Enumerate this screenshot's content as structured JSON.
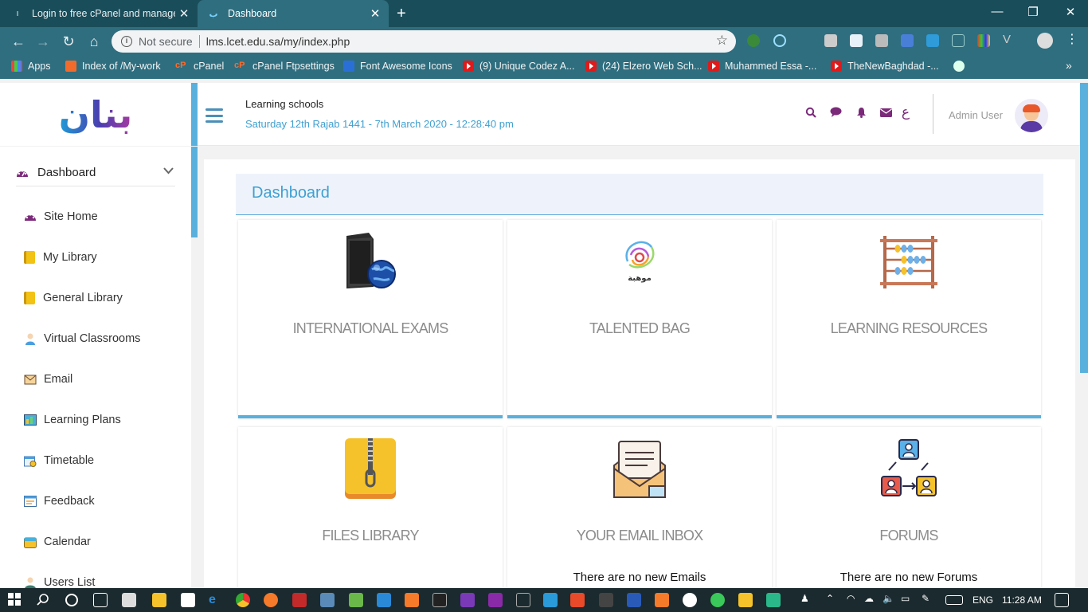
{
  "browser": {
    "tabs": [
      {
        "title": "Login to free cPanel and manage",
        "active": false
      },
      {
        "title": "Dashboard",
        "active": true
      }
    ],
    "new_tab": "+",
    "url_security": "Not secure",
    "url": "lms.lcet.edu.sa/my/index.php",
    "bookmarks": [
      {
        "label": "Apps",
        "icon": "apps-grid-icon"
      },
      {
        "label": "Index of /My-work",
        "icon": "folder-site-icon"
      },
      {
        "label": "cPanel",
        "icon": "cpanel-icon"
      },
      {
        "label": "cPanel Ftpsettings",
        "icon": "cpanel-icon"
      },
      {
        "label": "Font Awesome Icons",
        "icon": "flag-icon"
      },
      {
        "label": "(9) Unique Codez A...",
        "icon": "youtube-icon"
      },
      {
        "label": "(24) Elzero Web Sch...",
        "icon": "youtube-icon"
      },
      {
        "label": "Muhammed Essa -...",
        "icon": "youtube-icon"
      },
      {
        "label": "TheNewBaghdad -...",
        "icon": "youtube-icon"
      }
    ],
    "bookmarks_more": "»"
  },
  "header": {
    "logo_text": "بنان",
    "school": "Learning schools",
    "datetime": "Saturday 12th Rajab 1441 - 7th March 2020 - 12:28:40 pm",
    "language_toggle": "ع",
    "admin_name": "Admin User"
  },
  "sidebar": {
    "section": "Dashboard",
    "items": [
      {
        "label": "Site Home",
        "icon": "dashboard-gauge-icon"
      },
      {
        "label": "My Library",
        "icon": "book-icon"
      },
      {
        "label": "General Library",
        "icon": "book-icon"
      },
      {
        "label": "Virtual Classrooms",
        "icon": "user-icon"
      },
      {
        "label": "Email",
        "icon": "email-icon"
      },
      {
        "label": "Learning Plans",
        "icon": "plans-icon"
      },
      {
        "label": "Timetable",
        "icon": "timetable-icon"
      },
      {
        "label": "Feedback",
        "icon": "feedback-icon"
      },
      {
        "label": "Calendar",
        "icon": "calendar-icon"
      },
      {
        "label": "Users List",
        "icon": "users-icon"
      }
    ]
  },
  "main": {
    "title": "Dashboard",
    "cards": [
      {
        "title": "INTERNATIONAL EXAMS",
        "subtitle": ""
      },
      {
        "title": "TALENTED BAG",
        "subtitle": "",
        "logo_text": "موهبة"
      },
      {
        "title": "LEARNING RESOURCES",
        "subtitle": ""
      },
      {
        "title": "FILES LIBRARY",
        "subtitle": ""
      },
      {
        "title": "YOUR EMAIL INBOX",
        "subtitle": "There are no new Emails"
      },
      {
        "title": "FORUMS",
        "subtitle": "There are no new Forums"
      }
    ]
  },
  "taskbar": {
    "language": "ENG",
    "time": "11:28 AM"
  },
  "colors": {
    "accent": "#5ab0dc",
    "brand_purple": "#7b2a7a",
    "chrome_dark": "#1a4d5a",
    "chrome_light": "#2f6e7f"
  }
}
